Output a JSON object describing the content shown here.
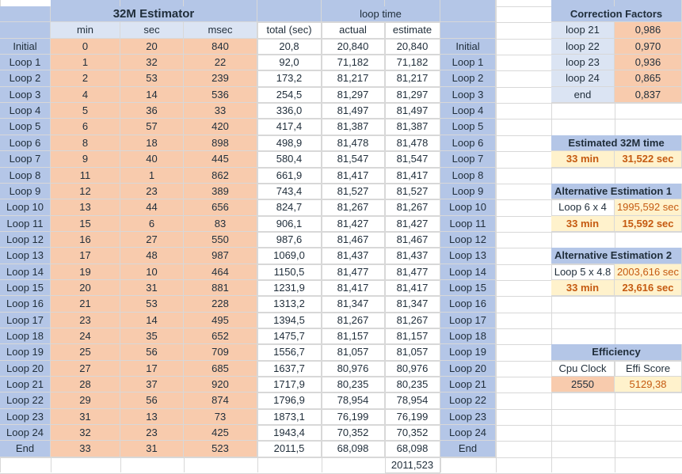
{
  "headers": {
    "title": "32M Estimator",
    "loop_time": "loop time",
    "min": "min",
    "sec": "sec",
    "msec": "msec",
    "total": "total (sec)",
    "actual": "actual",
    "estimate": "estimate"
  },
  "rows": [
    {
      "label": "Initial",
      "min": "0",
      "sec": "20",
      "msec": "840",
      "total": "20,8",
      "actual": "20,840",
      "estimate": "20,840",
      "label2": "Initial"
    },
    {
      "label": "Loop 1",
      "min": "1",
      "sec": "32",
      "msec": "22",
      "total": "92,0",
      "actual": "71,182",
      "estimate": "71,182",
      "label2": "Loop 1"
    },
    {
      "label": "Loop 2",
      "min": "2",
      "sec": "53",
      "msec": "239",
      "total": "173,2",
      "actual": "81,217",
      "estimate": "81,217",
      "label2": "Loop 2"
    },
    {
      "label": "Loop 3",
      "min": "4",
      "sec": "14",
      "msec": "536",
      "total": "254,5",
      "actual": "81,297",
      "estimate": "81,297",
      "label2": "Loop 3"
    },
    {
      "label": "Loop 4",
      "min": "5",
      "sec": "36",
      "msec": "33",
      "total": "336,0",
      "actual": "81,497",
      "estimate": "81,497",
      "label2": "Loop 4"
    },
    {
      "label": "Loop 5",
      "min": "6",
      "sec": "57",
      "msec": "420",
      "total": "417,4",
      "actual": "81,387",
      "estimate": "81,387",
      "label2": "Loop 5"
    },
    {
      "label": "Loop 6",
      "min": "8",
      "sec": "18",
      "msec": "898",
      "total": "498,9",
      "actual": "81,478",
      "estimate": "81,478",
      "label2": "Loop 6"
    },
    {
      "label": "Loop 7",
      "min": "9",
      "sec": "40",
      "msec": "445",
      "total": "580,4",
      "actual": "81,547",
      "estimate": "81,547",
      "label2": "Loop 7"
    },
    {
      "label": "Loop 8",
      "min": "11",
      "sec": "1",
      "msec": "862",
      "total": "661,9",
      "actual": "81,417",
      "estimate": "81,417",
      "label2": "Loop 8"
    },
    {
      "label": "Loop 9",
      "min": "12",
      "sec": "23",
      "msec": "389",
      "total": "743,4",
      "actual": "81,527",
      "estimate": "81,527",
      "label2": "Loop 9"
    },
    {
      "label": "Loop 10",
      "min": "13",
      "sec": "44",
      "msec": "656",
      "total": "824,7",
      "actual": "81,267",
      "estimate": "81,267",
      "label2": "Loop 10"
    },
    {
      "label": "Loop 11",
      "min": "15",
      "sec": "6",
      "msec": "83",
      "total": "906,1",
      "actual": "81,427",
      "estimate": "81,427",
      "label2": "Loop 11"
    },
    {
      "label": "Loop 12",
      "min": "16",
      "sec": "27",
      "msec": "550",
      "total": "987,6",
      "actual": "81,467",
      "estimate": "81,467",
      "label2": "Loop 12"
    },
    {
      "label": "Loop 13",
      "min": "17",
      "sec": "48",
      "msec": "987",
      "total": "1069,0",
      "actual": "81,437",
      "estimate": "81,437",
      "label2": "Loop 13"
    },
    {
      "label": "Loop 14",
      "min": "19",
      "sec": "10",
      "msec": "464",
      "total": "1150,5",
      "actual": "81,477",
      "estimate": "81,477",
      "label2": "Loop 14"
    },
    {
      "label": "Loop 15",
      "min": "20",
      "sec": "31",
      "msec": "881",
      "total": "1231,9",
      "actual": "81,417",
      "estimate": "81,417",
      "label2": "Loop 15"
    },
    {
      "label": "Loop 16",
      "min": "21",
      "sec": "53",
      "msec": "228",
      "total": "1313,2",
      "actual": "81,347",
      "estimate": "81,347",
      "label2": "Loop 16"
    },
    {
      "label": "Loop 17",
      "min": "23",
      "sec": "14",
      "msec": "495",
      "total": "1394,5",
      "actual": "81,267",
      "estimate": "81,267",
      "label2": "Loop 17"
    },
    {
      "label": "Loop 18",
      "min": "24",
      "sec": "35",
      "msec": "652",
      "total": "1475,7",
      "actual": "81,157",
      "estimate": "81,157",
      "label2": "Loop 18"
    },
    {
      "label": "Loop 19",
      "min": "25",
      "sec": "56",
      "msec": "709",
      "total": "1556,7",
      "actual": "81,057",
      "estimate": "81,057",
      "label2": "Loop 19"
    },
    {
      "label": "Loop 20",
      "min": "27",
      "sec": "17",
      "msec": "685",
      "total": "1637,7",
      "actual": "80,976",
      "estimate": "80,976",
      "label2": "Loop 20"
    },
    {
      "label": "Loop 21",
      "min": "28",
      "sec": "37",
      "msec": "920",
      "total": "1717,9",
      "actual": "80,235",
      "estimate": "80,235",
      "label2": "Loop 21"
    },
    {
      "label": "Loop 22",
      "min": "29",
      "sec": "56",
      "msec": "874",
      "total": "1796,9",
      "actual": "78,954",
      "estimate": "78,954",
      "label2": "Loop 22"
    },
    {
      "label": "Loop 23",
      "min": "31",
      "sec": "13",
      "msec": "73",
      "total": "1873,1",
      "actual": "76,199",
      "estimate": "76,199",
      "label2": "Loop 23"
    },
    {
      "label": "Loop 24",
      "min": "32",
      "sec": "23",
      "msec": "425",
      "total": "1943,4",
      "actual": "70,352",
      "estimate": "70,352",
      "label2": "Loop 24"
    },
    {
      "label": "End",
      "min": "33",
      "sec": "31",
      "msec": "523",
      "total": "2011,5",
      "actual": "68,098",
      "estimate": "68,098",
      "label2": "End"
    }
  ],
  "estimate_sum": "2011,523",
  "correction": {
    "title": "Correction Factors",
    "items": [
      {
        "label": "loop 21",
        "value": "0,986"
      },
      {
        "label": "loop 22",
        "value": "0,970"
      },
      {
        "label": "loop 23",
        "value": "0,936"
      },
      {
        "label": "loop 24",
        "value": "0,865"
      },
      {
        "label": "end",
        "value": "0,837"
      }
    ]
  },
  "estimated_time": {
    "title": "Estimated 32M time",
    "min": "33 min",
    "sec": "31,522 sec"
  },
  "alt1": {
    "title": "Alternative Estimation 1",
    "label": "Loop 6 x 4",
    "value": "1995,592 sec",
    "min": "33 min",
    "sec": "15,592 sec"
  },
  "alt2": {
    "title": "Alternative Estimation 2",
    "label": "Loop 5 x 4.8",
    "value": "2003,616 sec",
    "min": "33 min",
    "sec": "23,616 sec"
  },
  "efficiency": {
    "title": "Efficiency",
    "cpu_label": "Cpu Clock",
    "score_label": "Effi Score",
    "cpu": "2550",
    "score": "5129,38"
  },
  "colors": {
    "header_blue": "#b4c6e7",
    "input_orange": "#f8cbad",
    "result_yellow": "#fff2cc",
    "accent_text": "#c55a11"
  }
}
